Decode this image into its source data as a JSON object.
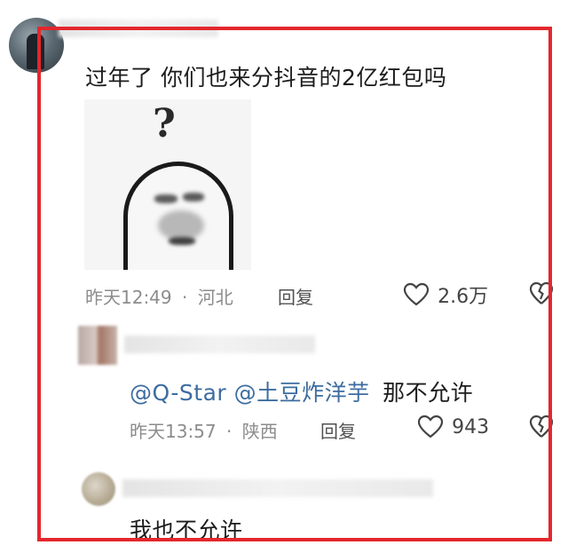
{
  "comments": [
    {
      "text": "过年了 你们也来分抖音的2亿红包吗",
      "time": "昨天12:49",
      "separator": "·",
      "location": "河北",
      "reply_label": "回复",
      "likes": "2.6万"
    }
  ],
  "reply": {
    "mention1": "@Q-Star",
    "mention2": "@土豆炸洋芋",
    "text": "那不允许",
    "time": "昨天13:57",
    "separator": "·",
    "location": "陕西",
    "reply_label": "回复",
    "likes": "943"
  },
  "third_comment": {
    "partial_text": "我也不允许"
  },
  "icons": {
    "like": "heart-outline-icon",
    "dislike": "broken-heart-icon",
    "question": "?"
  },
  "colors": {
    "highlight_border": "#e3272d",
    "mention": "#3d6ca0",
    "meta": "#8c8c8c"
  }
}
